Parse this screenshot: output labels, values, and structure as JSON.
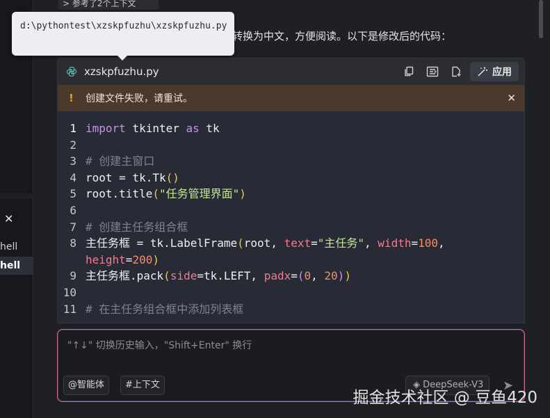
{
  "context": {
    "label": "> 参考了2个上下文"
  },
  "intro": {
    "text": "转换为中文，方便阅读。以下是修改后的代码："
  },
  "tooltip": {
    "text": "d:\\pythontest\\xzskpfuzhu\\xzskpfuzhu.py"
  },
  "left_panel": {
    "items": [
      "hell",
      "hell"
    ]
  },
  "code": {
    "filename": "xzskpfuzhu.py",
    "apply_label": "应用",
    "error_text": "创建文件失败，请重试。",
    "line_numbers": [
      "1",
      "2",
      "3",
      "4",
      "5",
      "6",
      "7",
      "8",
      "",
      "9",
      "10",
      "11"
    ],
    "l1": {
      "import": "import",
      "a": " tkinter ",
      "as": "as",
      "b": " tk"
    },
    "l3": "# 创建主窗口",
    "l4": {
      "a": "root = tk.Tk",
      "open": "(",
      "close": ")"
    },
    "l5": {
      "a": "root.title",
      "open": "(",
      "str": "\"任务管理界面\"",
      "close": ")"
    },
    "l7": "# 创建主任务组合框",
    "l8": {
      "a": "主任务框 = tk.LabelFrame",
      "open": "(",
      "b": "root, ",
      "text_kw": "text",
      "eq1": "=",
      "str": "\"主任务\"",
      "c": ", ",
      "width_kw": "width",
      "eq2": "=",
      "num": "100",
      "d": ","
    },
    "l8b": {
      "height_kw": "height",
      "eq": "=",
      "num": "200",
      "close": ")"
    },
    "l9": {
      "a": "主任务框.pack",
      "open": "(",
      "side_kw": "side",
      "eq1": "=",
      "b": "tk.LEFT, ",
      "padx_kw": "padx",
      "eq2": "=",
      "tup_open": "(",
      "n1": "0",
      "c": ", ",
      "n2": "20",
      "tup_close": ")",
      "close": ")"
    },
    "l11": "# 在主任务组合框中添加列表框"
  },
  "input": {
    "placeholder": "\"↑↓\" 切换历史输入，\"Shift+Enter\" 换行",
    "chip_agent": "@智能体",
    "chip_context": "#上下文",
    "model": "DeepSeek-V3"
  },
  "watermark": "掘金技术社区 @ 豆鱼420"
}
